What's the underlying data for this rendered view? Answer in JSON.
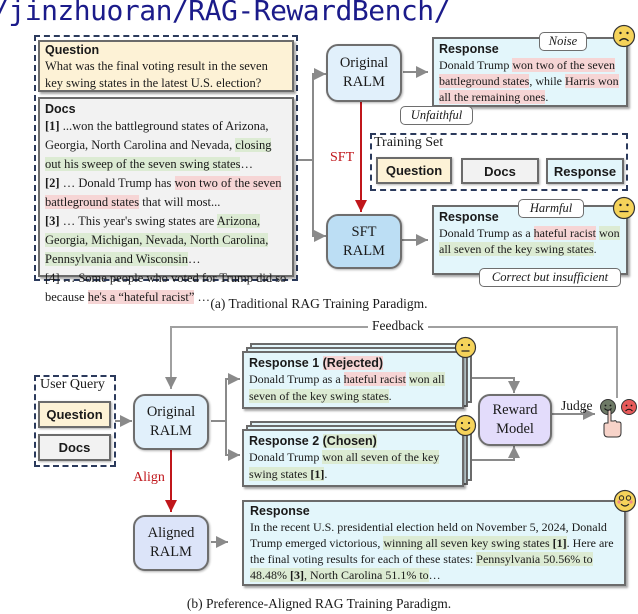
{
  "header": {
    "url_text": "/jinzhuoran/RAG-RewardBench/"
  },
  "panel_a": {
    "caption": "(a) Traditional RAG Training Paradigm.",
    "question": {
      "title": "Question",
      "text": "What was the final voting result in the seven key swing states in the latest U.S. election?"
    },
    "docs": {
      "title": "Docs",
      "items": [
        {
          "id": "[1]",
          "pre": " ...won the battleground states of Arizona, Georgia, North Carolina and Nevada, ",
          "hl": "closing out his sweep of the seven swing states",
          "hl_type": "green",
          "post": "…"
        },
        {
          "id": "[2]",
          "pre": " … Donald Trump has ",
          "hl": "won two of the seven battleground states",
          "hl_type": "red",
          "post": " that will most..."
        },
        {
          "id": "[3]",
          "pre": " … This year's swing states are ",
          "hl": "Arizona, Georgia, Michigan, Nevada, North Carolina, Pennsylvania and Wisconsin",
          "hl_type": "green",
          "post": "…"
        },
        {
          "id": "[4]",
          "pre": " … Some people who voted for Trump did so because ",
          "hl": "he's a “hateful racist”",
          "hl_type": "red",
          "post": " …"
        }
      ]
    },
    "original_ralm": {
      "line1": "Original",
      "line2": "RALM"
    },
    "sft_ralm": {
      "line1": "SFT",
      "line2": "RALM"
    },
    "sft_label": "SFT",
    "response_top": {
      "title": "Response",
      "pre": "Donald Trump ",
      "hl1": "won two of the seven battleground states",
      "mid": ", while ",
      "hl2": "Harris won all the remaining ones",
      "post": ".",
      "callout_noise": "Noise",
      "callout_unfaithful": "Unfaithful",
      "face": "sad-face"
    },
    "training_set": {
      "title": "Training Set",
      "items": [
        "Question",
        "Docs",
        "Response"
      ]
    },
    "response_bottom": {
      "title": "Response",
      "pre": "Donald Trump as a ",
      "hl_red": "hateful racist",
      "hl_green": "won all seven of the key swing states",
      "post": ".",
      "callout_harmful": "Harmful",
      "callout_insufficient": "Correct but insufficient",
      "face": "neutral-face"
    }
  },
  "panel_b": {
    "caption": "(b) Preference-Aligned RAG Training Paradigm.",
    "feedback_label": "Feedback",
    "user_query": {
      "title": "User Query",
      "items": [
        "Question",
        "Docs"
      ]
    },
    "original_ralm": {
      "line1": "Original",
      "line2": "RALM"
    },
    "align_label": "Align",
    "aligned_ralm": {
      "line1": "Aligned",
      "line2": "RALM"
    },
    "response1": {
      "title": "Response 1 ",
      "tag": "(Rejected)",
      "pre": "Donald Trump as a ",
      "hl_red": "hateful racist",
      "hl_green": "won all seven of the key swing states",
      "post": "."
    },
    "response2": {
      "title": "Response 2 ",
      "tag": "(Chosen)",
      "pre": "Donald Trump ",
      "hl_green": "won all seven of the key swing states ",
      "cite": "[1]",
      "post": "."
    },
    "reward_model": {
      "line1": "Reward",
      "line2": "Model"
    },
    "judge_label": "Judge",
    "final_response": {
      "title": "Response",
      "pre": "In the recent U.S. presidential election held on November 5, 2024, Donald Trump emerged victorious, ",
      "hl1": "winning all seven key swing states ",
      "cite1": "[1]",
      "mid": ". Here are the final voting results for each of these states: ",
      "hl2": "Pennsylvania 50.56% to 48.48% ",
      "cite3": "[3]",
      "hl3": ", North Carolina 51.1% to",
      "post": "…"
    }
  },
  "colors": {
    "question_bg": "#fdf2d6",
    "docs_bg": "#f2f2f2",
    "response_bg": "#e3f6fb",
    "highlight_red": "#f6d5d5",
    "highlight_green": "#dcebd3",
    "arrow_red": "#c0161b",
    "url_blue": "#1b1b8a"
  }
}
